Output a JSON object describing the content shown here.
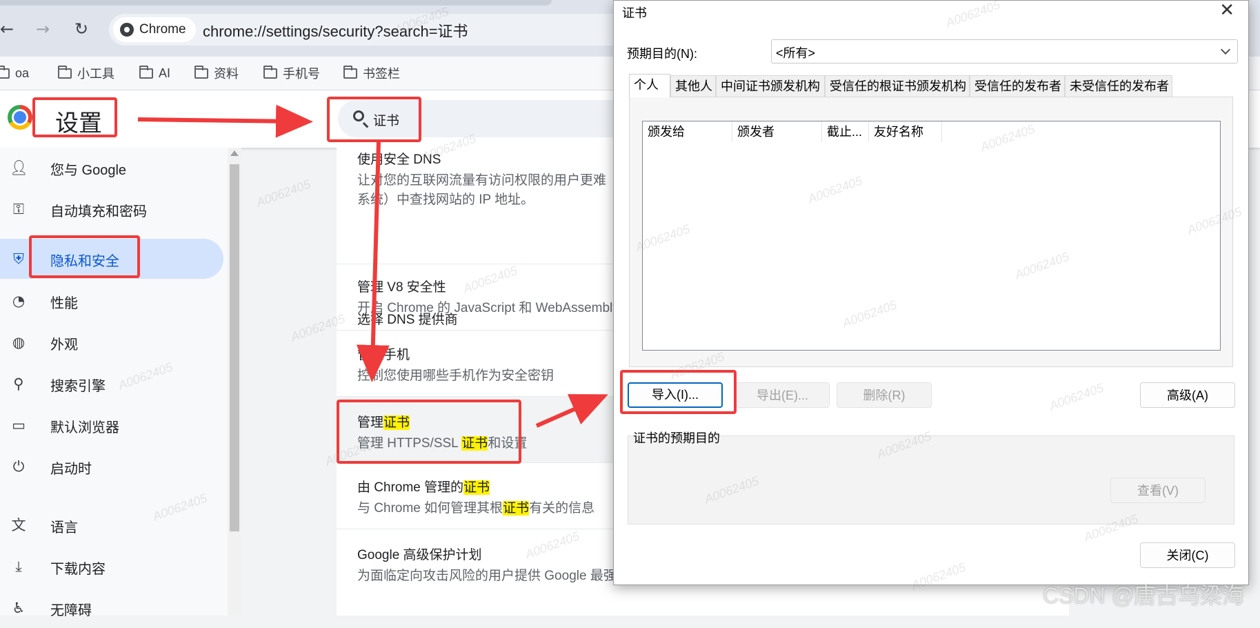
{
  "browser": {
    "chip_label": "Chrome",
    "url": "chrome://settings/security?search=证书",
    "bookmarks": [
      {
        "label": "oa"
      },
      {
        "label": "小工具"
      },
      {
        "label": "AI"
      },
      {
        "label": "资料"
      },
      {
        "label": "手机号"
      },
      {
        "label": "书签栏"
      }
    ]
  },
  "settings": {
    "title": "设置",
    "search_value": "证书",
    "nav": [
      {
        "label": "您与 Google",
        "icon": "person-icon"
      },
      {
        "label": "自动填充和密码",
        "icon": "key-icon"
      },
      {
        "label": "隐私和安全",
        "icon": "shield-icon",
        "active": true
      },
      {
        "label": "性能",
        "icon": "gauge-icon"
      },
      {
        "label": "外观",
        "icon": "palette-icon"
      },
      {
        "label": "搜索引擎",
        "icon": "search-icon"
      },
      {
        "label": "默认浏览器",
        "icon": "browser-window-icon"
      },
      {
        "label": "启动时",
        "icon": "power-icon"
      },
      {
        "label": "语言",
        "icon": "translate-icon"
      },
      {
        "label": "下载内容",
        "icon": "download-icon"
      },
      {
        "label": "无障碍",
        "icon": "accessibility-icon"
      }
    ],
    "rows": {
      "dns_title": "使用安全 DNS",
      "dns_desc1": "让对您的互联网流量有访问权限的用户更难",
      "dns_desc2": "系统）中查找网站的 IP 地址。",
      "dns_provider": "选择 DNS 提供商",
      "v8_title": "管理 V8 安全性",
      "v8_desc": "开启 Chrome 的 JavaScript 和 WebAssembly",
      "phone_title": "管理手机",
      "phone_desc": "控制您使用哪些手机作为安全密钥",
      "cert_title_prefix": "管理",
      "cert_title_highlight": "证书",
      "cert_desc_prefix": "管理 HTTPS/SSL ",
      "cert_desc_highlight": "证书",
      "cert_desc_suffix": "和设置",
      "chrome_cert_prefix": "由 Chrome 管理的",
      "chrome_cert_highlight": "证书",
      "chrome_cert_desc_prefix": "与 Chrome 如何管理其根",
      "chrome_cert_desc_highlight": "证书",
      "chrome_cert_desc_suffix": "有关的信息",
      "gap_title": "Google 高级保护计划",
      "gap_desc": "为面临定向攻击风险的用户提供 Google 最强"
    }
  },
  "dialog": {
    "title": "证书",
    "purpose_label": "预期目的(N):",
    "purpose_value": "<所有>",
    "tabs": [
      "个人",
      "其他人",
      "中间证书颁发机构",
      "受信任的根证书颁发机构",
      "受信任的发布者",
      "未受信任的发布者"
    ],
    "columns": [
      "颁发给",
      "颁发者",
      "截止...",
      "友好名称"
    ],
    "buttons": {
      "import": "导入(I)...",
      "export": "导出(E)...",
      "remove": "删除(R)",
      "advanced": "高级(A)",
      "view": "查看(V)",
      "close": "关闭(C)"
    },
    "group_label": "证书的预期目的"
  },
  "watermark": {
    "text": "A0062405",
    "credit": "CSDN @唐古乌梁海"
  },
  "colors": {
    "annotation_red": "#ef3b3b",
    "highlight": "#fff200",
    "active_nav": "#d3e3fd",
    "active_nav_text": "#0b57d0"
  }
}
